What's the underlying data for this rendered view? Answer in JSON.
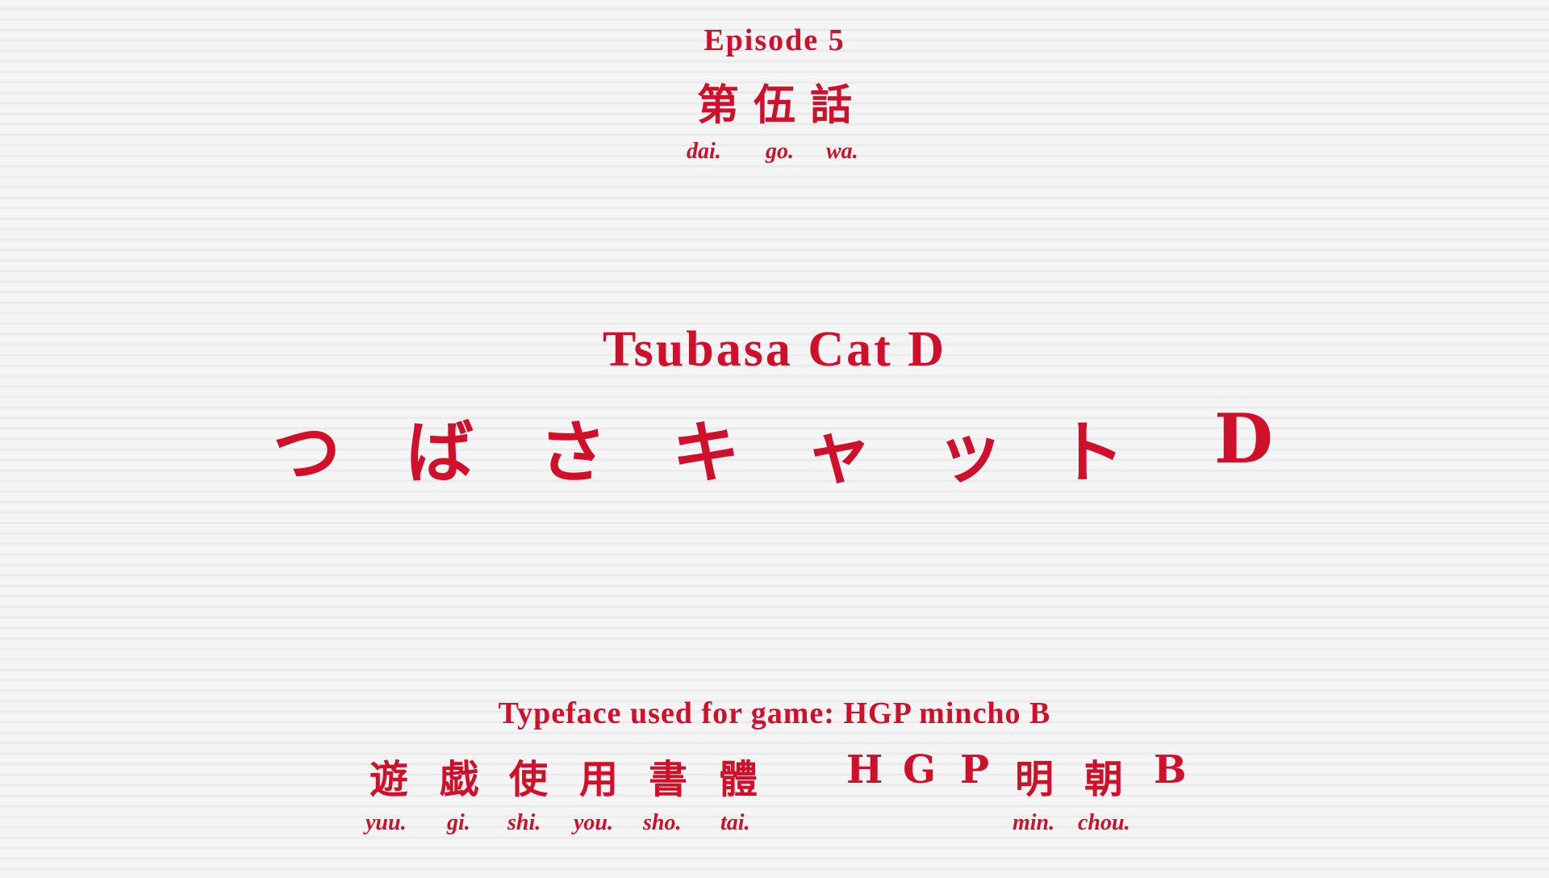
{
  "episode": {
    "label": "Episode 5",
    "kanji": "第 伍 話",
    "romaji": [
      "dai.",
      "go.",
      "wa."
    ]
  },
  "title": {
    "english": "Tsubasa Cat D",
    "kana": [
      "つ",
      "ば",
      "さ",
      "キ",
      "ャ",
      "ッ",
      "ト",
      "D"
    ]
  },
  "typeface": {
    "english": "Typeface used for game: HGP mincho B",
    "kanji": [
      "遊",
      "戯",
      "使",
      "用",
      "書",
      "體",
      "H",
      "G",
      "P",
      "明",
      "朝",
      "B"
    ],
    "romaji": [
      "yuu.",
      "gi.",
      "shi.",
      "you.",
      "sho.",
      "tai.",
      "min.",
      "chou."
    ]
  },
  "colors": {
    "text": "#d0102a",
    "background": "#f1f1f1"
  }
}
